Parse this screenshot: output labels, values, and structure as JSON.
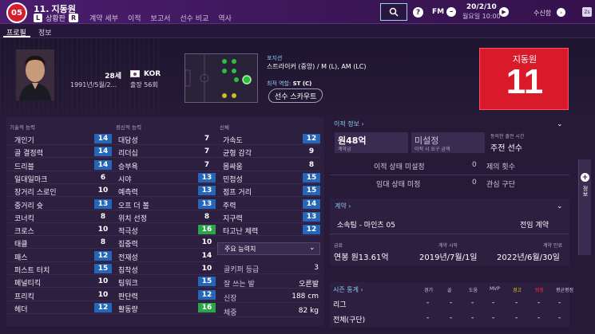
{
  "header": {
    "club_crest": "05",
    "squad_number": "11.",
    "player_name": "지동원",
    "foot_badge": "L",
    "status_text": "상황판",
    "role_badge": "R",
    "nav": [
      "계약 세부",
      "이적",
      "보고서",
      "선수 비교",
      "역사"
    ],
    "fm_label": "FM",
    "date": "20/2/10",
    "time": "월요일 10:00",
    "inbox": "수신함",
    "user_badge": "Zs"
  },
  "tabs": [
    "프로필",
    "정보"
  ],
  "profile": {
    "age": "28세",
    "dob": "1991년/5월/2...",
    "nation": "KOR",
    "caps": "출장 56회",
    "position_label": "포지션",
    "position_value": "스트라이커 (중앙) / M (L), AM (LC)",
    "role_label": "최적 역할:",
    "role_value": "ST (C)",
    "scout_button": "선수 스카우트",
    "jersey_name": "지동원",
    "jersey_number": "11"
  },
  "attributes": {
    "technical_header": "기술적 능력",
    "mental_header": "정신적 능력",
    "physical_header": "신체",
    "technical": [
      {
        "label": "개인기",
        "value": "14",
        "style": "blue"
      },
      {
        "label": "골 결정력",
        "value": "14",
        "style": "blue"
      },
      {
        "label": "드리블",
        "value": "14",
        "style": "blue"
      },
      {
        "label": "일대일마크",
        "value": "6",
        "style": "plain"
      },
      {
        "label": "장거리 스로인",
        "value": "10",
        "style": "plain"
      },
      {
        "label": "중거리 슛",
        "value": "13",
        "style": "blue"
      },
      {
        "label": "코너킥",
        "value": "8",
        "style": "plain"
      },
      {
        "label": "크로스",
        "value": "10",
        "style": "plain"
      },
      {
        "label": "태클",
        "value": "8",
        "style": "plain"
      },
      {
        "label": "패스",
        "value": "12",
        "style": "blue"
      },
      {
        "label": "퍼스트 터치",
        "value": "15",
        "style": "blue"
      },
      {
        "label": "페널티킥",
        "value": "10",
        "style": "plain"
      },
      {
        "label": "프리킥",
        "value": "10",
        "style": "plain"
      },
      {
        "label": "헤더",
        "value": "12",
        "style": "blue"
      }
    ],
    "mental": [
      {
        "label": "대담성",
        "value": "7",
        "style": "plain"
      },
      {
        "label": "리더십",
        "value": "7",
        "style": "plain"
      },
      {
        "label": "승부욕",
        "value": "7",
        "style": "plain"
      },
      {
        "label": "시야",
        "value": "13",
        "style": "blue"
      },
      {
        "label": "예측력",
        "value": "13",
        "style": "blue"
      },
      {
        "label": "오프 더 볼",
        "value": "13",
        "style": "blue"
      },
      {
        "label": "위치 선정",
        "value": "8",
        "style": "plain"
      },
      {
        "label": "적극성",
        "value": "16",
        "style": "green"
      },
      {
        "label": "집중력",
        "value": "10",
        "style": "plain"
      },
      {
        "label": "전재성",
        "value": "14",
        "style": "plain"
      },
      {
        "label": "침착성",
        "value": "10",
        "style": "plain"
      },
      {
        "label": "팀워크",
        "value": "15",
        "style": "blue"
      },
      {
        "label": "판단력",
        "value": "12",
        "style": "blue"
      },
      {
        "label": "활동량",
        "value": "16",
        "style": "green"
      }
    ],
    "physical": [
      {
        "label": "가속도",
        "value": "12",
        "style": "blue"
      },
      {
        "label": "균형 감각",
        "value": "9",
        "style": "plain"
      },
      {
        "label": "몸싸움",
        "value": "8",
        "style": "plain"
      },
      {
        "label": "민첩성",
        "value": "15",
        "style": "blue"
      },
      {
        "label": "점프 거리",
        "value": "15",
        "style": "blue"
      },
      {
        "label": "주력",
        "value": "14",
        "style": "blue"
      },
      {
        "label": "지구력",
        "value": "13",
        "style": "blue"
      },
      {
        "label": "타고난 체력",
        "value": "12",
        "style": "blue"
      }
    ],
    "key_attributes_dropdown": "주요 능력치",
    "info": [
      {
        "label": "골키퍼 등급",
        "value": "3"
      },
      {
        "label": "잘 쓰는 발",
        "value": "오른발"
      },
      {
        "label": "신장",
        "value": "188 cm"
      },
      {
        "label": "체중",
        "value": "82 kg"
      }
    ]
  },
  "transfer": {
    "heading": "이적 정보",
    "value_big": "원48억",
    "value_small": "계약금",
    "status_big": "미설정",
    "status_small": "이적 시 요구 금액",
    "req_label": "동의한 출전 시간",
    "req_value": "주전 선수",
    "rows": [
      {
        "label": "이적 상태 미설정",
        "num": "0",
        "desc": "제의 횟수"
      },
      {
        "label": "임대 상태 미정",
        "num": "0",
        "desc": "관심 구단"
      }
    ]
  },
  "contract": {
    "heading": "계약",
    "club": "소속팀 - 마인츠 05",
    "status": "전임 계약",
    "wage_label": "급료",
    "wage_value": "연봉 원13.61억",
    "start_label": "계약 시작",
    "start_value": "2019년/7월/1일",
    "end_label": "계약 만료",
    "end_value": "2022년/6월/30일"
  },
  "season": {
    "heading": "시즌 통계",
    "columns": [
      "경기",
      "골",
      "도움",
      "MVP",
      "경고",
      "퇴장",
      "평균평점"
    ],
    "rows": [
      {
        "label": "리그",
        "cells": [
          "-",
          "-",
          "-",
          "-",
          "-",
          "-",
          "-"
        ]
      },
      {
        "label": "전체(구단)",
        "cells": [
          "-",
          "-",
          "-",
          "-",
          "-",
          "-",
          "-"
        ]
      }
    ]
  },
  "sidebar": {
    "label": "정보"
  }
}
